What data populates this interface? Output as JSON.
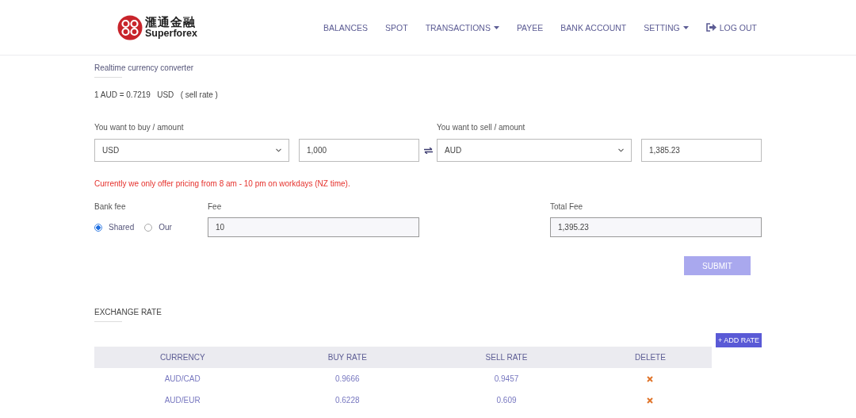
{
  "header": {
    "logo": {
      "chinese": "滙通金融",
      "english": "Superforex"
    },
    "nav": [
      {
        "label": "BALANCES",
        "kind": "link"
      },
      {
        "label": "SPOT",
        "kind": "link"
      },
      {
        "label": "TRANSACTIONS",
        "kind": "dropdown"
      },
      {
        "label": "PAYEE",
        "kind": "link"
      },
      {
        "label": "BANK ACCOUNT",
        "kind": "link"
      },
      {
        "label": "SETTING",
        "kind": "dropdown"
      },
      {
        "label": "LOG OUT",
        "kind": "logout"
      }
    ]
  },
  "converter": {
    "title": "Realtime currency converter",
    "rate_text": "1 AUD = 0.7219   USD   ( sell rate )",
    "buy": {
      "label": "You want to buy / amount",
      "currency": "USD",
      "amount": "1,000"
    },
    "sell": {
      "label": "You want to sell / amount",
      "currency": "AUD",
      "amount": "1,385.23"
    },
    "notice": "Currently we only offer pricing from 8 am - 10 pm on workdays (NZ time).",
    "bank_fee": {
      "label": "Bank fee",
      "options": [
        {
          "label": "Shared",
          "selected": true
        },
        {
          "label": "Our",
          "selected": false
        }
      ]
    },
    "fee": {
      "label": "Fee",
      "value": "10"
    },
    "total_fee": {
      "label": "Total Fee",
      "value": "1,395.23"
    },
    "submit": {
      "label": "SUBMIT",
      "disabled": true
    }
  },
  "exchange_rate": {
    "title": "EXCHANGE RATE",
    "add_button": "+ ADD RATE",
    "columns": [
      "CURRENCY",
      "BUY RATE",
      "SELL RATE",
      "DELETE"
    ],
    "rows": [
      {
        "currency": "AUD/CAD",
        "buy_rate": "0.9666",
        "sell_rate": "0.9457"
      },
      {
        "currency": "AUD/EUR",
        "buy_rate": "0.6228",
        "sell_rate": "0.609"
      }
    ]
  }
}
